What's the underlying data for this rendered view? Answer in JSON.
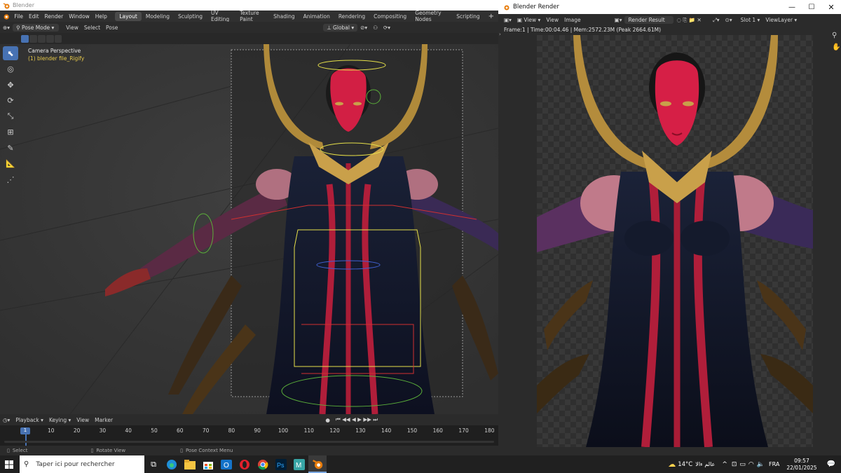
{
  "blender": {
    "title": "Blender",
    "menu": [
      "File",
      "Edit",
      "Render",
      "Window",
      "Help"
    ],
    "workspaces": [
      "Layout",
      "Modeling",
      "Sculpting",
      "UV Editing",
      "Texture Paint",
      "Shading",
      "Animation",
      "Rendering",
      "Compositing",
      "Geometry Nodes",
      "Scripting"
    ],
    "active_workspace": "Layout",
    "header": {
      "mode": "Pose Mode",
      "view": "View",
      "select": "Select",
      "pose": "Pose",
      "orientation": "Global"
    },
    "viewport": {
      "perspective": "Camera Perspective",
      "object": "(1) blender file_Rigify"
    },
    "timeline": {
      "playback": "Playback",
      "keying": "Keying",
      "view": "View",
      "marker": "Marker",
      "current_frame": "1",
      "ticks": [
        "10",
        "20",
        "30",
        "40",
        "50",
        "60",
        "70",
        "80",
        "90",
        "100",
        "110",
        "120",
        "130",
        "140",
        "150",
        "160",
        "170",
        "180"
      ]
    },
    "status": {
      "select": "Select",
      "rotate": "Rotate View",
      "context": "Pose Context Menu"
    }
  },
  "render": {
    "title": "Blender Render",
    "view": "View",
    "view2": "View",
    "image": "Image",
    "result": "Render Result",
    "slot": "Slot 1",
    "layer": "ViewLayer",
    "info": "Frame:1 | Time:00:04.46 | Mem:2572.23M (Peak 2664.61M)"
  },
  "taskbar": {
    "search_placeholder": "Taper ici pour rechercher",
    "weather": "14°C",
    "weather_text": "عالم ءالا",
    "language": "FRA",
    "time": "09:57",
    "date": "22/01/2025"
  },
  "colors": {
    "accent": "#4772b3",
    "selection": "#e6e04a",
    "frame": "#4772b3"
  }
}
